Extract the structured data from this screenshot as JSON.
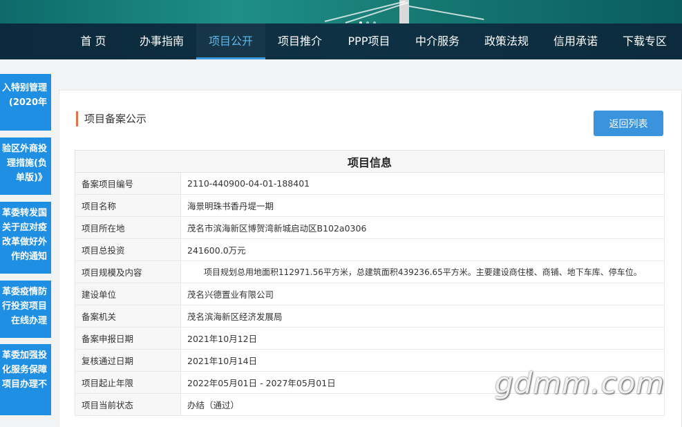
{
  "nav": {
    "items": [
      "首 页",
      "办事指南",
      "项目公开",
      "项目推介",
      "PPP项目",
      "中介服务",
      "政策法规",
      "信用承诺",
      "下载专区"
    ],
    "active": "项目公开"
  },
  "sidebar": {
    "cards": [
      [
        "入特别管理",
        "(2020年"
      ],
      [
        "验区外商投",
        "理措施(负",
        "单版)》"
      ],
      [
        "革委转发国",
        "关于应对疫",
        "改革做好外",
        "作的通知"
      ],
      [
        "革委疫情防",
        "行投资项目",
        "在线办理"
      ],
      [
        "革委加强投",
        "化服务保障",
        "项目办理不"
      ]
    ]
  },
  "panel": {
    "title": "项目备案公示",
    "back_button": "返回列表"
  },
  "table": {
    "caption": "项目信息",
    "rows": [
      {
        "label": "备案项目编号",
        "value": "2110-440900-04-01-188401"
      },
      {
        "label": "项目名称",
        "value": "海景明珠书香丹堤一期"
      },
      {
        "label": "项目所在地",
        "value": "茂名市滨海新区博贺湾新城启动区B102a0306"
      },
      {
        "label": "项目总投资",
        "value": "241600.0万元"
      },
      {
        "label": "项目规模及内容",
        "value": "项目规划总用地面积112971.56平方米，总建筑面积439236.65平方米。主要建设商住楼、商铺、地下车库、停车位。"
      },
      {
        "label": "建设单位",
        "value": "茂名兴德置业有限公司"
      },
      {
        "label": "备案机关",
        "value": "茂名滨海新区经济发展局"
      },
      {
        "label": "备案申报日期",
        "value": "2021年10月12日"
      },
      {
        "label": "复核通过日期",
        "value": "2021年10月14日"
      },
      {
        "label": "项目起止年限",
        "value": "2022年05月01日 - 2027年05月01日"
      },
      {
        "label": "项目当前状态",
        "value": "办结（通过）"
      }
    ]
  },
  "watermark": "gdmm.com"
}
